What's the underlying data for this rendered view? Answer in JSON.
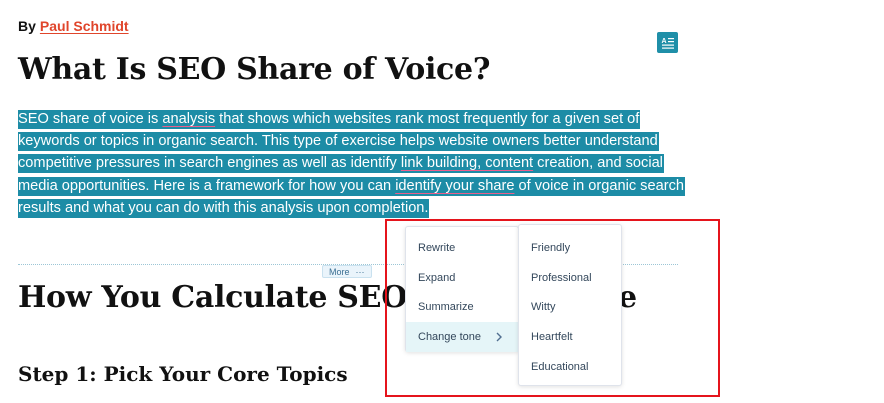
{
  "byline": {
    "prefix": "By",
    "author": "Paul Schmidt"
  },
  "article": {
    "title": "What Is SEO Share of Voice?",
    "paragraph_lines": [
      [
        {
          "t": "SEO share of voice is "
        },
        {
          "t": "analysis",
          "u": true
        },
        {
          "t": " that shows which websites rank most frequently for a given set of"
        }
      ],
      [
        {
          "t": "keywords or topics in organic search. This type of exercise helps website owners better understand"
        }
      ],
      [
        {
          "t": "competitive pressures in search engines as well as identify "
        },
        {
          "t": "link building, content",
          "u": true
        },
        {
          "t": " creation, and social"
        }
      ],
      [
        {
          "t": "media opportunities. Here is a framework for how you can "
        },
        {
          "t": "identify your share",
          "u": true
        },
        {
          "t": " of voice in organic search"
        }
      ],
      [
        {
          "t": "results and what you can do with this analysis upon completion."
        }
      ]
    ],
    "more_label": "More",
    "heading2_start": "How You Calculate SEO",
    "heading2_end": "e",
    "heading3": "Step 1: Pick Your Core Topics"
  },
  "menu": {
    "items": [
      {
        "label": "Rewrite"
      },
      {
        "label": "Expand"
      },
      {
        "label": "Summarize"
      },
      {
        "label": "Change tone",
        "active": true,
        "submenu": true
      }
    ]
  },
  "tone_menu": {
    "items": [
      "Friendly",
      "Professional",
      "Witty",
      "Heartfelt",
      "Educational"
    ]
  },
  "colors": {
    "selection": "#1d8ca6",
    "author_link": "#e0452b",
    "highlight_box": "#e5141c",
    "menu_text": "#33475b"
  }
}
